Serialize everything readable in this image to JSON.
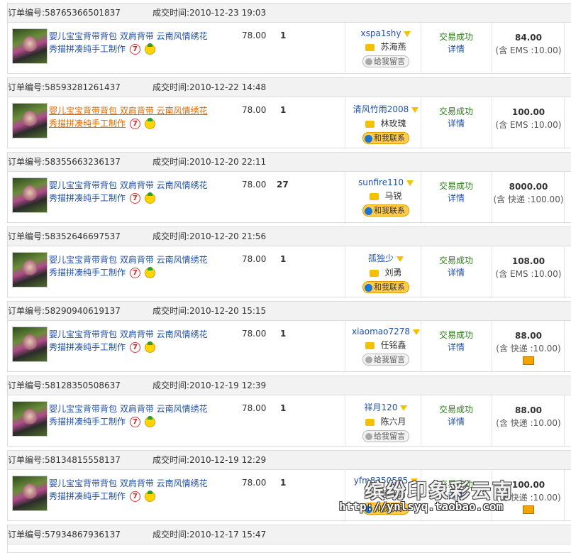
{
  "labels": {
    "order_no": "订单编号:",
    "deal_time": "成交时间:",
    "status_ok": "交易成功",
    "details": "详情",
    "leave_msg": "给我留言",
    "contact_me": "和我联系"
  },
  "orders": [
    {
      "order_no": "58765366501837",
      "time": "2010-12-23 19:03",
      "title1": "婴儿宝宝背带背包 双肩背带 云南风情绣花",
      "title2": "秀描拼凑纯手工制作",
      "price": "78.00",
      "qty": "1",
      "nick": "xspa1shy",
      "real_name": "苏海燕",
      "action": "leave",
      "total": "84.00",
      "shipping": "(含 EMS :10.00)",
      "highlight": false,
      "card": false
    },
    {
      "order_no": "58593281261437",
      "time": "2010-12-22 14:48",
      "title1": "婴儿宝宝背带背包 双肩背带 云南风情绣花",
      "title2": "秀描拼凑纯手工制作",
      "price": "78.00",
      "qty": "1",
      "nick": "清风竹雨2008",
      "real_name": "林玫瑰",
      "action": "contact",
      "total": "100.00",
      "shipping": "(含 EMS :10.00)",
      "highlight": true,
      "card": false
    },
    {
      "order_no": "58355663236137",
      "time": "2010-12-20 22:11",
      "title1": "婴儿宝宝背带背包 双肩背带 云南风情绣花",
      "title2": "秀描拼凑纯手工制作",
      "price": "78.00",
      "qty": "27",
      "nick": "sunfire110",
      "real_name": "马锐",
      "action": "contact",
      "total": "8000.00",
      "shipping": "(含 快递 :100.00)",
      "highlight": false,
      "card": false
    },
    {
      "order_no": "58352646697537",
      "time": "2010-12-20 21:56",
      "title1": "婴儿宝宝背带背包 双肩背带 云南风情绣花",
      "title2": "秀描拼凑纯手工制作",
      "price": "78.00",
      "qty": "1",
      "nick": "孤独少",
      "real_name": "刘勇",
      "action": "contact",
      "total": "108.00",
      "shipping": "(含 EMS :10.00)",
      "highlight": false,
      "card": false
    },
    {
      "order_no": "58290940619137",
      "time": "2010-12-20 15:15",
      "title1": "婴儿宝宝背带背包 双肩背带 云南风情绣花",
      "title2": "秀描拼凑纯手工制作",
      "price": "78.00",
      "qty": "1",
      "nick": "xiaomao7278",
      "real_name": "任铭鑫",
      "action": "leave",
      "total": "88.00",
      "shipping": "(含 快递 :10.00)",
      "highlight": false,
      "card": true
    },
    {
      "order_no": "58128350508637",
      "time": "2010-12-19 12:39",
      "title1": "婴儿宝宝背带背包 双肩背带 云南风情绣花",
      "title2": "秀描拼凑纯手工制作",
      "price": "78.00",
      "qty": "1",
      "nick": "祥月120",
      "real_name": "陈六月",
      "action": "leave",
      "total": "88.00",
      "shipping": "(含 快递 :10.00)",
      "highlight": false,
      "card": false
    },
    {
      "order_no": "58134815558137",
      "time": "2010-12-19 12:29",
      "title1": "婴儿宝宝背带背包 双肩背带 云南风情绣花",
      "title2": "秀描拼凑纯手工制作",
      "price": "78.00",
      "qty": "1",
      "nick": "yfm8350585",
      "real_name": "颜伏苗",
      "action": "contact",
      "total": "100.00",
      "shipping": "(含 快递 :10.00)",
      "highlight": false,
      "card": true
    },
    {
      "order_no": "57934867936137",
      "time": "2010-12-17 15:47",
      "title1": "",
      "title2": "",
      "price": "",
      "qty": "",
      "nick": "",
      "real_name": "",
      "action": "",
      "total": "",
      "shipping": "",
      "highlight": false,
      "card": false
    }
  ],
  "watermark": {
    "line1": "缤纷印象彩云南",
    "line2": "http://ynlsyq.taobao.com"
  }
}
